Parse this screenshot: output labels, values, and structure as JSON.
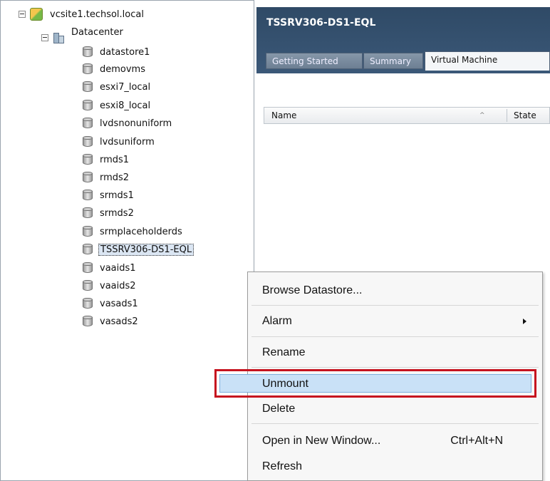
{
  "tree": {
    "root": "vcsite1.techsol.local",
    "datacenter": "Datacenter",
    "datastores": [
      "datastore1",
      "demovms",
      "esxi7_local",
      "esxi8_local",
      "lvdsnonuniform",
      "lvdsuniform",
      "rmds1",
      "rmds2",
      "srmds1",
      "srmds2",
      "srmplaceholderds",
      "TSSRV306-DS1-EQL",
      "vaaids1",
      "vaaids2",
      "vasads1",
      "vasads2"
    ],
    "selected": "TSSRV306-DS1-EQL"
  },
  "panel": {
    "title": "TSSRV306-DS1-EQL",
    "tabs": [
      "Getting Started",
      "Summary",
      "Virtual Machine"
    ],
    "active_tab": "Virtual Machine",
    "columns": [
      "Name",
      "State"
    ]
  },
  "context_menu": {
    "items": [
      {
        "label": "Browse Datastore..."
      },
      {
        "label": "Alarm",
        "submenu": true
      },
      {
        "label": "Rename"
      },
      {
        "label": "Unmount",
        "highlighted": true
      },
      {
        "label": "Delete"
      },
      {
        "label": "Open in New Window...",
        "shortcut": "Ctrl+Alt+N"
      },
      {
        "label": "Refresh"
      }
    ],
    "highlight_color": "#c6131f"
  }
}
